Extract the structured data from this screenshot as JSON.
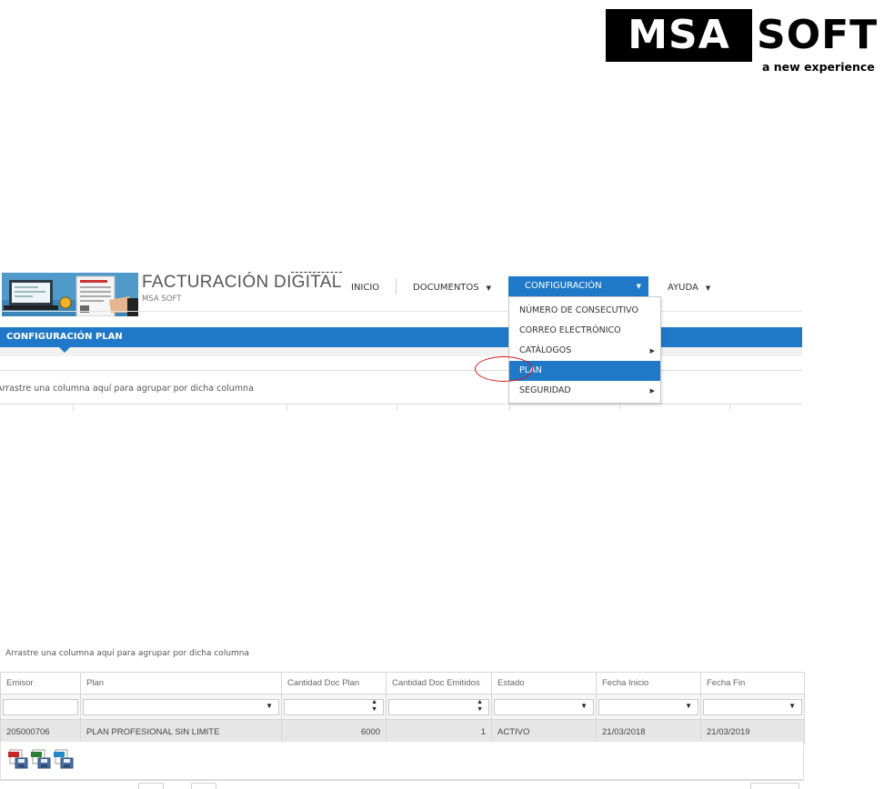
{
  "logo": {
    "brand_left": "MSA",
    "brand_right": "SOFT",
    "tagline": "a new experience"
  },
  "app": {
    "title": "FACTURACIÓN DIGITAL",
    "subtitle": "MSA SOFT",
    "nav": {
      "inicio": "INICIO",
      "documentos": "DOCUMENTOS",
      "configuracion": "CONFIGURACIÓN",
      "ayuda": "AYUDA"
    },
    "dropdown": [
      {
        "label": "NÚMERO DE CONSECUTIVO"
      },
      {
        "label": "CORREO ELECTRÓNICO"
      },
      {
        "label": "CATÁLOGOS"
      },
      {
        "label": "PLAN"
      },
      {
        "label": "SEGURIDAD"
      }
    ],
    "section_title": "CONFIGURACIÓN PLAN",
    "group_hint": "Arrastre una columna aquí para agrupar por dicha columna"
  },
  "grid": {
    "group_hint": "Arrastre una columna aquí para agrupar por dicha columna",
    "columns": [
      "Emisor",
      "Plan",
      "Cantidad Doc Plan",
      "Cantidad Doc Emitidos",
      "Estado",
      "Fecha Inicio",
      "Fecha Fin"
    ],
    "row": {
      "emisor": "205000706",
      "plan": "PLAN PROFESIONAL SIN LIMITE",
      "cantidad_plan": "6000",
      "cantidad_emitidos": "1",
      "estado": "ACTIVO",
      "fecha_inicio": "21/03/2018",
      "fecha_fin": "21/03/2019"
    },
    "exports": [
      "pdf-export-icon",
      "xls-export-icon",
      "csv-export-icon"
    ]
  },
  "colors": {
    "accent": "#1f78c8",
    "highlight_oval": "#d01818"
  }
}
